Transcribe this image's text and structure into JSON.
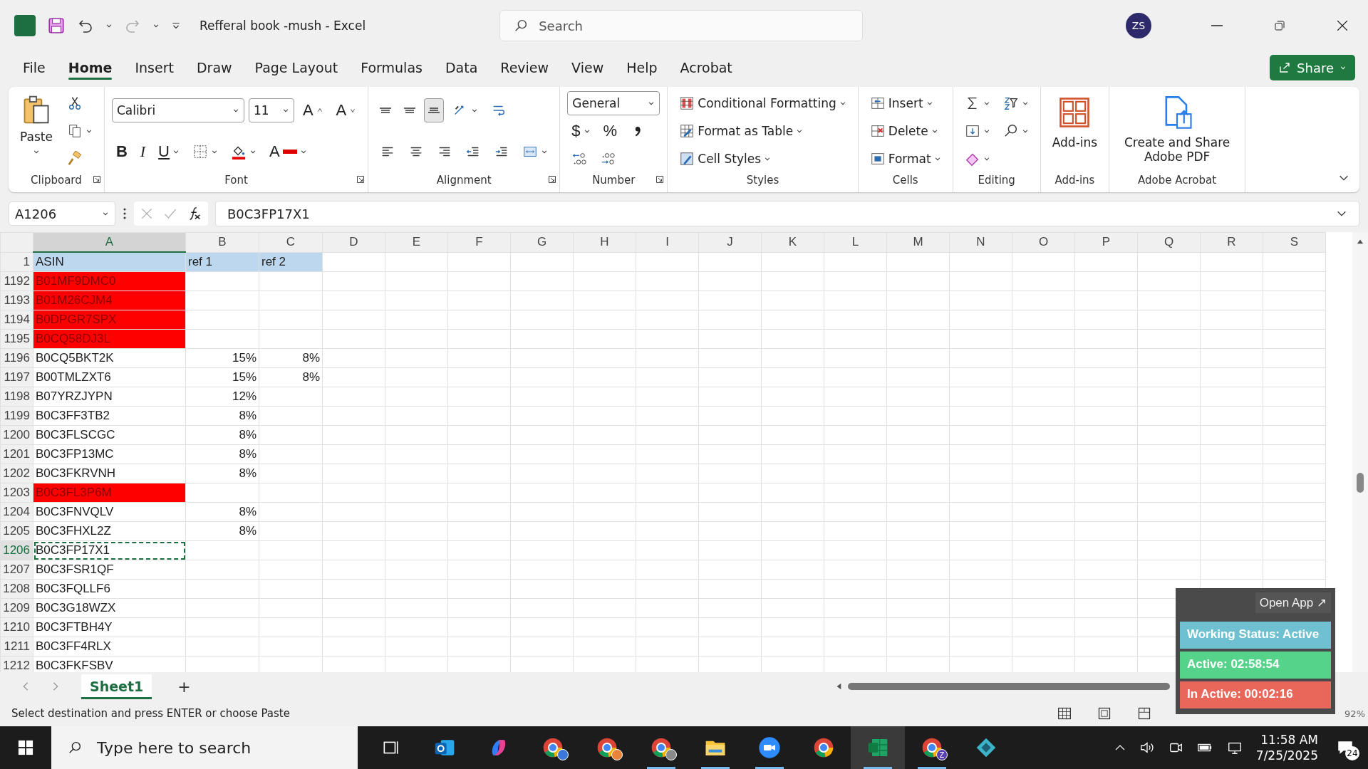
{
  "title_bar": {
    "title": "Refferal book -mush  -  Excel",
    "search_placeholder": "Search",
    "avatar": "ZS"
  },
  "menu_tabs": [
    {
      "label": "File",
      "selected": false
    },
    {
      "label": "Home",
      "selected": true
    },
    {
      "label": "Insert",
      "selected": false
    },
    {
      "label": "Draw",
      "selected": false
    },
    {
      "label": "Page Layout",
      "selected": false
    },
    {
      "label": "Formulas",
      "selected": false
    },
    {
      "label": "Data",
      "selected": false
    },
    {
      "label": "Review",
      "selected": false
    },
    {
      "label": "View",
      "selected": false
    },
    {
      "label": "Help",
      "selected": false
    },
    {
      "label": "Acrobat",
      "selected": false
    }
  ],
  "share_button": "Share",
  "ribbon": [
    {
      "label": "Clipboard",
      "launcher": true,
      "large": [
        {
          "kind": "paste",
          "label": "Paste",
          "dropdown": true
        }
      ],
      "lines": [
        {
          "items": [
            {
              "kind": "cut",
              "dropdown": false
            }
          ]
        },
        {
          "items": [
            {
              "kind": "copy",
              "dropdown": true
            }
          ]
        },
        {
          "items": [
            {
              "kind": "format-painter",
              "dropdown": false
            }
          ]
        }
      ]
    },
    {
      "label": "Font",
      "launcher": true,
      "lines": [
        {
          "items": [
            {
              "kind": "select",
              "value": "Calibri"
            },
            {
              "kind": "select",
              "value": "11"
            },
            {
              "kind": "grow",
              "label": "A",
              "dropdown": false
            },
            {
              "kind": "shrink",
              "label": "A",
              "dropdown": false
            }
          ]
        },
        {
          "items": [
            {
              "kind": "bold",
              "label": "B",
              "dropdown": false
            },
            {
              "kind": "italic",
              "label": "I",
              "dropdown": false
            },
            {
              "kind": "underline",
              "label": "U",
              "dropdown": true
            },
            {
              "kind": "borders",
              "dropdown": true
            },
            {
              "kind": "fill-color",
              "dropdown": true
            },
            {
              "kind": "font-color",
              "label": "A",
              "dropdown": true
            }
          ]
        }
      ]
    },
    {
      "label": "Alignment",
      "launcher": true,
      "lines": [
        {
          "items": [
            {
              "kind": "align-top",
              "selected": false,
              "dropdown": false
            },
            {
              "kind": "align-middle",
              "selected": false,
              "dropdown": false
            },
            {
              "kind": "align-bottom",
              "selected": true,
              "dropdown": false
            },
            {
              "kind": "orientation",
              "selected": false,
              "dropdown": true
            },
            {
              "kind": "wrap",
              "selected": false,
              "dropdown": false
            }
          ]
        },
        {
          "items": [
            {
              "kind": "align-left",
              "selected": false,
              "dropdown": false
            },
            {
              "kind": "align-center",
              "selected": false,
              "dropdown": false
            },
            {
              "kind": "align-right",
              "selected": false,
              "dropdown": false
            },
            {
              "kind": "outdent",
              "selected": false,
              "dropdown": false
            },
            {
              "kind": "indent",
              "selected": false,
              "dropdown": false
            },
            {
              "kind": "merge",
              "selected": false,
              "dropdown": true
            }
          ]
        }
      ]
    },
    {
      "label": "Number",
      "launcher": true,
      "lines": [
        {
          "items": [
            {
              "kind": "select",
              "value": "General"
            }
          ]
        },
        {
          "items": [
            {
              "kind": "currency",
              "label": "$",
              "dropdown": true
            },
            {
              "kind": "percent",
              "label": "%",
              "dropdown": false
            },
            {
              "kind": "comma",
              "dropdown": false
            }
          ]
        },
        {
          "items": [
            {
              "kind": "inc-decimal",
              "dropdown": false
            },
            {
              "kind": "dec-decimal",
              "dropdown": false
            }
          ]
        }
      ]
    },
    {
      "label": "Styles",
      "launcher": false,
      "lines": [
        {
          "items": [
            {
              "kind": "conditional",
              "label": "Conditional Formatting",
              "dropdown": true
            }
          ]
        },
        {
          "items": [
            {
              "kind": "format-table",
              "label": "Format as Table",
              "dropdown": true
            }
          ]
        },
        {
          "items": [
            {
              "kind": "cell-styles",
              "label": "Cell Styles",
              "dropdown": true
            }
          ]
        }
      ]
    },
    {
      "label": "Cells",
      "launcher": false,
      "lines": [
        {
          "items": [
            {
              "kind": "insert-cells",
              "label": "Insert",
              "dropdown": true
            }
          ]
        },
        {
          "items": [
            {
              "kind": "delete-cells",
              "label": "Delete",
              "dropdown": true
            }
          ]
        },
        {
          "items": [
            {
              "kind": "format-cells",
              "label": "Format",
              "dropdown": true
            }
          ]
        }
      ]
    },
    {
      "label": "Editing",
      "launcher": false,
      "lines": [
        {
          "items": [
            {
              "kind": "sum",
              "dropdown": true
            },
            {
              "kind": "sort-filter",
              "dropdown": true
            }
          ]
        },
        {
          "items": [
            {
              "kind": "fill-down",
              "dropdown": true
            },
            {
              "kind": "find",
              "dropdown": true
            }
          ]
        },
        {
          "items": [
            {
              "kind": "eraser",
              "dropdown": true
            }
          ]
        }
      ]
    },
    {
      "label": "Add-ins",
      "launcher": false,
      "large": [
        {
          "kind": "addins",
          "label": "Add-ins",
          "dropdown": false
        }
      ]
    },
    {
      "label": "Adobe Acrobat",
      "launcher": false,
      "large": [
        {
          "kind": "pdf",
          "label": "Create and Share Adobe PDF",
          "dropdown": false
        }
      ]
    }
  ],
  "formula_bar": {
    "name_box": "A1206",
    "value": "B0C3FP17X1"
  },
  "columns": [
    {
      "label": "A",
      "selected": true
    },
    {
      "label": "B",
      "selected": false
    },
    {
      "label": "C",
      "selected": false
    },
    {
      "label": "D",
      "selected": false
    },
    {
      "label": "E",
      "selected": false
    },
    {
      "label": "F",
      "selected": false
    },
    {
      "label": "G",
      "selected": false
    },
    {
      "label": "H",
      "selected": false
    },
    {
      "label": "I",
      "selected": false
    },
    {
      "label": "J",
      "selected": false
    },
    {
      "label": "K",
      "selected": false
    },
    {
      "label": "L",
      "selected": false
    },
    {
      "label": "M",
      "selected": false
    },
    {
      "label": "N",
      "selected": false
    },
    {
      "label": "O",
      "selected": false
    },
    {
      "label": "P",
      "selected": false
    },
    {
      "label": "Q",
      "selected": false
    },
    {
      "label": "R",
      "selected": false
    },
    {
      "label": "S",
      "selected": false
    }
  ],
  "rows": [
    {
      "number": "1",
      "kind": "header",
      "flagged": false,
      "selected": false,
      "cells": [
        "ASIN",
        "ref 1",
        "ref 2"
      ]
    },
    {
      "number": "1192",
      "kind": "data",
      "flagged": true,
      "selected": false,
      "cells": [
        "B01MF9DMC0"
      ]
    },
    {
      "number": "1193",
      "kind": "data",
      "flagged": true,
      "selected": false,
      "cells": [
        "B01M26CJM4"
      ]
    },
    {
      "number": "1194",
      "kind": "data",
      "flagged": true,
      "selected": false,
      "cells": [
        "B0DPGR7SPX"
      ]
    },
    {
      "number": "1195",
      "kind": "data",
      "flagged": true,
      "selected": false,
      "cells": [
        "B0CQ58DJ3L"
      ]
    },
    {
      "number": "1196",
      "kind": "data",
      "flagged": false,
      "selected": false,
      "cells": [
        "B0CQ5BKT2K",
        "15%",
        "8%"
      ]
    },
    {
      "number": "1197",
      "kind": "data",
      "flagged": false,
      "selected": false,
      "cells": [
        "B00TMLZXT6",
        "15%",
        "8%"
      ]
    },
    {
      "number": "1198",
      "kind": "data",
      "flagged": false,
      "selected": false,
      "cells": [
        "B07YRZJYPN",
        "12%"
      ]
    },
    {
      "number": "1199",
      "kind": "data",
      "flagged": false,
      "selected": false,
      "cells": [
        "B0C3FF3TB2",
        "8%"
      ]
    },
    {
      "number": "1200",
      "kind": "data",
      "flagged": false,
      "selected": false,
      "cells": [
        "B0C3FLSCGC",
        "8%"
      ]
    },
    {
      "number": "1201",
      "kind": "data",
      "flagged": false,
      "selected": false,
      "cells": [
        "B0C3FP13MC",
        "8%"
      ]
    },
    {
      "number": "1202",
      "kind": "data",
      "flagged": false,
      "selected": false,
      "cells": [
        "B0C3FKRVNH",
        "8%"
      ]
    },
    {
      "number": "1203",
      "kind": "data",
      "flagged": true,
      "selected": false,
      "cells": [
        "B0C3FL3P6M"
      ]
    },
    {
      "number": "1204",
      "kind": "data",
      "flagged": false,
      "selected": false,
      "cells": [
        "B0C3FNVQLV",
        "8%"
      ]
    },
    {
      "number": "1205",
      "kind": "data",
      "flagged": false,
      "selected": false,
      "cells": [
        "B0C3FHXL2Z",
        "8%"
      ]
    },
    {
      "number": "1206",
      "kind": "data",
      "flagged": false,
      "selected": true,
      "cells": [
        "B0C3FP17X1"
      ]
    },
    {
      "number": "1207",
      "kind": "data",
      "flagged": false,
      "selected": false,
      "cells": [
        "B0C3FSR1QF"
      ]
    },
    {
      "number": "1208",
      "kind": "data",
      "flagged": false,
      "selected": false,
      "cells": [
        "B0C3FQLLF6"
      ]
    },
    {
      "number": "1209",
      "kind": "data",
      "flagged": false,
      "selected": false,
      "cells": [
        "B0C3G18WZX"
      ]
    },
    {
      "number": "1210",
      "kind": "data",
      "flagged": false,
      "selected": false,
      "cells": [
        "B0C3FTBH4Y"
      ]
    },
    {
      "number": "1211",
      "kind": "data",
      "flagged": false,
      "selected": false,
      "cells": [
        "B0C3FF4RLX"
      ]
    },
    {
      "number": "1212",
      "kind": "data",
      "flagged": false,
      "selected": false,
      "cells": [
        "B0C3FKFSBV"
      ]
    }
  ],
  "sheet_tabs": [
    {
      "label": "Sheet1",
      "selected": true
    }
  ],
  "add_sheet": "+",
  "status_bar": {
    "message": "Select destination and press ENTER or choose Paste",
    "zoom": "92%"
  },
  "tracker": {
    "open_app": "Open App ↗",
    "status": "Working Status: Active",
    "active": "Active: 02:58:54",
    "inactive": "In Active: 00:02:16"
  },
  "taskbar": {
    "search_placeholder": "Type here to search",
    "apps": [
      {
        "kind": "task-view",
        "running": false,
        "selected": false
      },
      {
        "kind": "mail",
        "running": false,
        "selected": false
      },
      {
        "kind": "copilot",
        "running": false,
        "selected": false
      },
      {
        "kind": "browser",
        "color": "#3b78d8",
        "running": false,
        "selected": false
      },
      {
        "kind": "browser",
        "color": "#e8833a",
        "running": false,
        "selected": false
      },
      {
        "kind": "browser",
        "color": "#8a8a8a",
        "running": true,
        "selected": false
      },
      {
        "kind": "folder",
        "running": true,
        "selected": false
      },
      {
        "kind": "video",
        "running": true,
        "selected": false
      },
      {
        "kind": "browser",
        "running": false,
        "selected": false
      },
      {
        "kind": "sheet",
        "running": true,
        "selected": true
      },
      {
        "kind": "browser",
        "color": "#5b3fb0",
        "badge": "Z",
        "running": true,
        "selected": false
      },
      {
        "kind": "diamond",
        "running": false,
        "selected": false
      }
    ],
    "time": "11:58 AM",
    "date": "7/25/2025",
    "notifications": "24"
  }
}
